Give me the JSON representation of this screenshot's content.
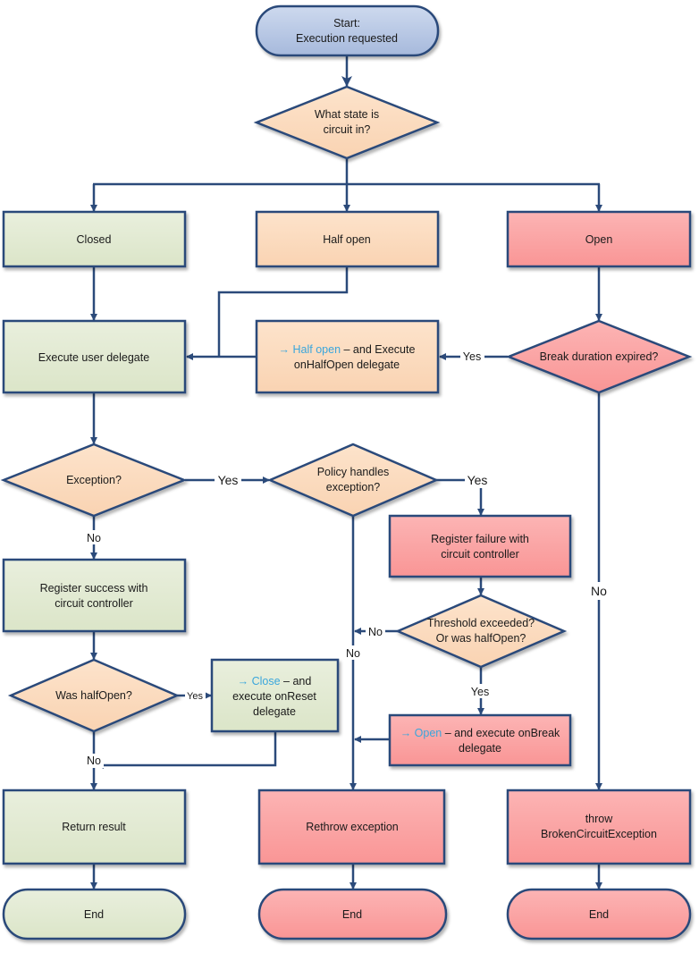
{
  "colors": {
    "stroke": "#2b4a7a",
    "closed_green": "#e2ead2",
    "half_open_orange": "#fbdcc0",
    "open_red": "#fba5a5",
    "start_blue": "#b9c9e4",
    "highlight_blue": "#3aa6dc"
  },
  "nodes": {
    "start": [
      "Start:",
      "Execution requested"
    ],
    "state_decision": [
      "What state is",
      "circuit in?"
    ],
    "closed": "Closed",
    "half_open": "Half open",
    "open": "Open",
    "execute_user_delegate": "Execute user delegate",
    "half_open_execute": {
      "highlight": "→ Half open",
      "rest": " – and Execute",
      "line2": "onHalfOpen delegate"
    },
    "break_duration": "Break duration expired?",
    "exception_decision": "Exception?",
    "policy_handles": [
      "Policy handles",
      "exception?"
    ],
    "register_failure": [
      "Register failure with",
      "circuit controller"
    ],
    "register_success": [
      "Register success with",
      "circuit controller"
    ],
    "threshold": [
      "Threshold exceeded?",
      "Or was halfOpen?"
    ],
    "was_half_open": "Was halfOpen?",
    "close_reset": {
      "highlight": "→ Close",
      "rest": " – and",
      "line2": "execute onReset",
      "line3": "delegate"
    },
    "open_break": {
      "highlight": "→ Open",
      "rest": " – and execute onBreak",
      "line2": "delegate"
    },
    "return_result": "Return result",
    "rethrow": "Rethrow exception",
    "throw_broken": [
      "throw",
      "BrokenCircuitException"
    ],
    "end_left": "End",
    "end_middle": "End",
    "end_right": "End"
  },
  "edge_labels": {
    "break_yes": "Yes",
    "break_no": "No",
    "exception_yes": "Yes",
    "exception_no": "No",
    "policy_yes": "Yes",
    "policy_no": "No",
    "threshold_no": "No",
    "threshold_yes": "Yes",
    "halfopen_yes": "Yes",
    "halfopen_no": "No"
  }
}
